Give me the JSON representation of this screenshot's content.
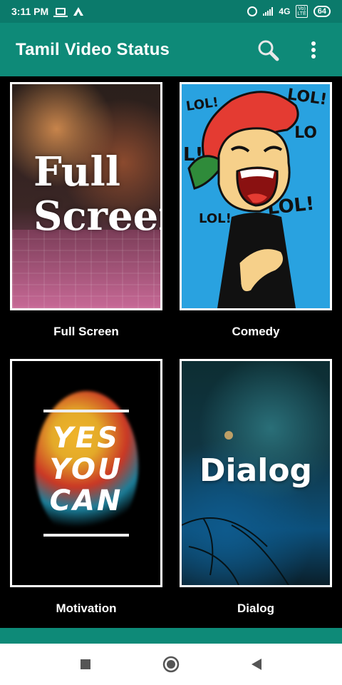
{
  "status_bar": {
    "time": "3:11 PM",
    "network": "4G",
    "lte_top": "Vo)",
    "lte_bottom": "LTE",
    "battery": "64"
  },
  "app_bar": {
    "title": "Tamil Video Status",
    "icons": [
      "search-icon",
      "more-vert-icon"
    ]
  },
  "categories": [
    {
      "label": "Full Screen",
      "thumb_text": [
        "Full",
        "Screen"
      ]
    },
    {
      "label": "Comedy",
      "thumb_text": [
        "LOL!",
        "LOL!",
        "LO",
        "L!",
        "LOL!",
        "LOL!"
      ]
    },
    {
      "label": "Motivation",
      "thumb_text": [
        "YES",
        "YOU",
        "CAN"
      ]
    },
    {
      "label": "Dialog",
      "thumb_text": [
        "Dialog"
      ]
    }
  ],
  "nav": [
    "recents-square-icon",
    "home-circle-icon",
    "back-triangle-icon"
  ],
  "colors": {
    "primary": "#0e8a78",
    "status": "#0b7a6b",
    "background": "#000000"
  }
}
